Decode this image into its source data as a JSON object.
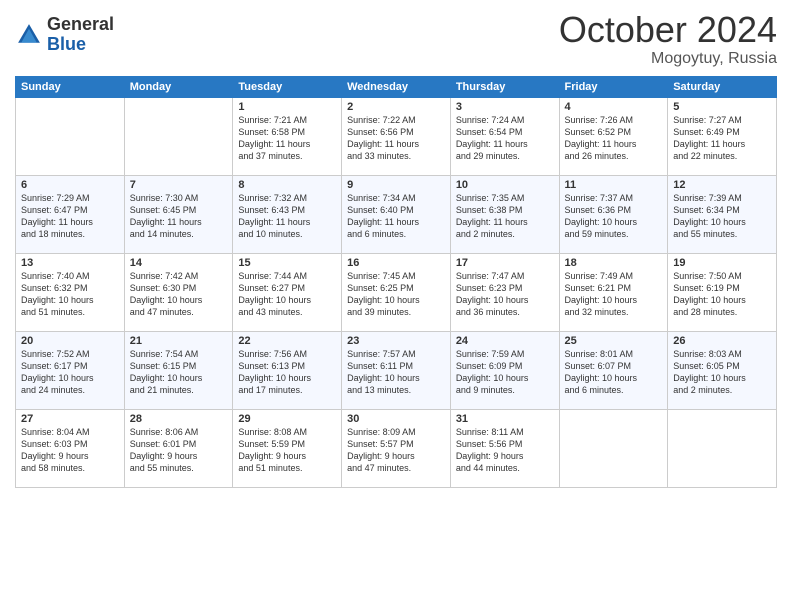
{
  "header": {
    "logo_general": "General",
    "logo_blue": "Blue",
    "month": "October 2024",
    "location": "Mogoytuy, Russia"
  },
  "days_of_week": [
    "Sunday",
    "Monday",
    "Tuesday",
    "Wednesday",
    "Thursday",
    "Friday",
    "Saturday"
  ],
  "weeks": [
    [
      {
        "day": "",
        "text": ""
      },
      {
        "day": "",
        "text": ""
      },
      {
        "day": "1",
        "text": "Sunrise: 7:21 AM\nSunset: 6:58 PM\nDaylight: 11 hours\nand 37 minutes."
      },
      {
        "day": "2",
        "text": "Sunrise: 7:22 AM\nSunset: 6:56 PM\nDaylight: 11 hours\nand 33 minutes."
      },
      {
        "day": "3",
        "text": "Sunrise: 7:24 AM\nSunset: 6:54 PM\nDaylight: 11 hours\nand 29 minutes."
      },
      {
        "day": "4",
        "text": "Sunrise: 7:26 AM\nSunset: 6:52 PM\nDaylight: 11 hours\nand 26 minutes."
      },
      {
        "day": "5",
        "text": "Sunrise: 7:27 AM\nSunset: 6:49 PM\nDaylight: 11 hours\nand 22 minutes."
      }
    ],
    [
      {
        "day": "6",
        "text": "Sunrise: 7:29 AM\nSunset: 6:47 PM\nDaylight: 11 hours\nand 18 minutes."
      },
      {
        "day": "7",
        "text": "Sunrise: 7:30 AM\nSunset: 6:45 PM\nDaylight: 11 hours\nand 14 minutes."
      },
      {
        "day": "8",
        "text": "Sunrise: 7:32 AM\nSunset: 6:43 PM\nDaylight: 11 hours\nand 10 minutes."
      },
      {
        "day": "9",
        "text": "Sunrise: 7:34 AM\nSunset: 6:40 PM\nDaylight: 11 hours\nand 6 minutes."
      },
      {
        "day": "10",
        "text": "Sunrise: 7:35 AM\nSunset: 6:38 PM\nDaylight: 11 hours\nand 2 minutes."
      },
      {
        "day": "11",
        "text": "Sunrise: 7:37 AM\nSunset: 6:36 PM\nDaylight: 10 hours\nand 59 minutes."
      },
      {
        "day": "12",
        "text": "Sunrise: 7:39 AM\nSunset: 6:34 PM\nDaylight: 10 hours\nand 55 minutes."
      }
    ],
    [
      {
        "day": "13",
        "text": "Sunrise: 7:40 AM\nSunset: 6:32 PM\nDaylight: 10 hours\nand 51 minutes."
      },
      {
        "day": "14",
        "text": "Sunrise: 7:42 AM\nSunset: 6:30 PM\nDaylight: 10 hours\nand 47 minutes."
      },
      {
        "day": "15",
        "text": "Sunrise: 7:44 AM\nSunset: 6:27 PM\nDaylight: 10 hours\nand 43 minutes."
      },
      {
        "day": "16",
        "text": "Sunrise: 7:45 AM\nSunset: 6:25 PM\nDaylight: 10 hours\nand 39 minutes."
      },
      {
        "day": "17",
        "text": "Sunrise: 7:47 AM\nSunset: 6:23 PM\nDaylight: 10 hours\nand 36 minutes."
      },
      {
        "day": "18",
        "text": "Sunrise: 7:49 AM\nSunset: 6:21 PM\nDaylight: 10 hours\nand 32 minutes."
      },
      {
        "day": "19",
        "text": "Sunrise: 7:50 AM\nSunset: 6:19 PM\nDaylight: 10 hours\nand 28 minutes."
      }
    ],
    [
      {
        "day": "20",
        "text": "Sunrise: 7:52 AM\nSunset: 6:17 PM\nDaylight: 10 hours\nand 24 minutes."
      },
      {
        "day": "21",
        "text": "Sunrise: 7:54 AM\nSunset: 6:15 PM\nDaylight: 10 hours\nand 21 minutes."
      },
      {
        "day": "22",
        "text": "Sunrise: 7:56 AM\nSunset: 6:13 PM\nDaylight: 10 hours\nand 17 minutes."
      },
      {
        "day": "23",
        "text": "Sunrise: 7:57 AM\nSunset: 6:11 PM\nDaylight: 10 hours\nand 13 minutes."
      },
      {
        "day": "24",
        "text": "Sunrise: 7:59 AM\nSunset: 6:09 PM\nDaylight: 10 hours\nand 9 minutes."
      },
      {
        "day": "25",
        "text": "Sunrise: 8:01 AM\nSunset: 6:07 PM\nDaylight: 10 hours\nand 6 minutes."
      },
      {
        "day": "26",
        "text": "Sunrise: 8:03 AM\nSunset: 6:05 PM\nDaylight: 10 hours\nand 2 minutes."
      }
    ],
    [
      {
        "day": "27",
        "text": "Sunrise: 8:04 AM\nSunset: 6:03 PM\nDaylight: 9 hours\nand 58 minutes."
      },
      {
        "day": "28",
        "text": "Sunrise: 8:06 AM\nSunset: 6:01 PM\nDaylight: 9 hours\nand 55 minutes."
      },
      {
        "day": "29",
        "text": "Sunrise: 8:08 AM\nSunset: 5:59 PM\nDaylight: 9 hours\nand 51 minutes."
      },
      {
        "day": "30",
        "text": "Sunrise: 8:09 AM\nSunset: 5:57 PM\nDaylight: 9 hours\nand 47 minutes."
      },
      {
        "day": "31",
        "text": "Sunrise: 8:11 AM\nSunset: 5:56 PM\nDaylight: 9 hours\nand 44 minutes."
      },
      {
        "day": "",
        "text": ""
      },
      {
        "day": "",
        "text": ""
      }
    ]
  ]
}
